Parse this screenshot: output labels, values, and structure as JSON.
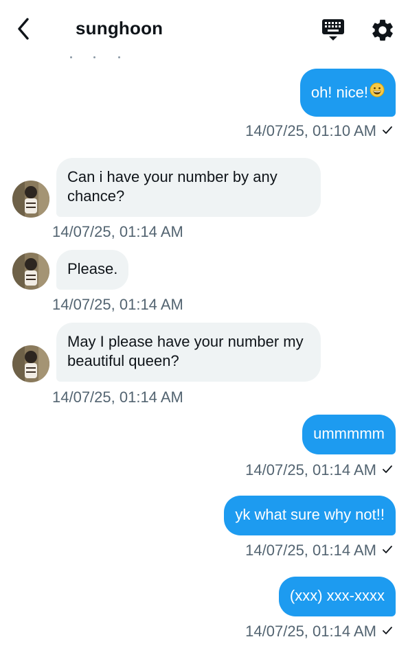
{
  "header": {
    "title": "sunghoon",
    "back_icon": "chevron-left-icon",
    "keyboard_icon": "keyboard-icon",
    "settings_icon": "gear-icon"
  },
  "colors": {
    "sent_bubble": "#1d9bf0",
    "received_bubble": "#eff3f4",
    "timestamp": "#536471",
    "title": "#0f1419"
  },
  "messages": [
    {
      "direction": "sent",
      "text": "oh! nice!",
      "emoji": "grinning-face-emoji",
      "timestamp": "14/07/25, 01:10 AM",
      "status": "✓"
    },
    {
      "direction": "received",
      "text": "Can i have your number by any chance?",
      "timestamp": "14/07/25, 01:14 AM"
    },
    {
      "direction": "received",
      "text": "Please.",
      "timestamp": "14/07/25, 01:14 AM"
    },
    {
      "direction": "received",
      "text": "May I please have your number my beautiful queen?",
      "timestamp": "14/07/25, 01:14 AM"
    },
    {
      "direction": "sent",
      "text": "ummmmm",
      "timestamp": "14/07/25, 01:14 AM",
      "status": "✓"
    },
    {
      "direction": "sent",
      "text": "yk what sure why not!!",
      "timestamp": "14/07/25, 01:14 AM",
      "status": "✓"
    },
    {
      "direction": "sent",
      "text": "(xxx) xxx-xxxx",
      "timestamp": "14/07/25, 01:14 AM",
      "status": "✓"
    }
  ]
}
